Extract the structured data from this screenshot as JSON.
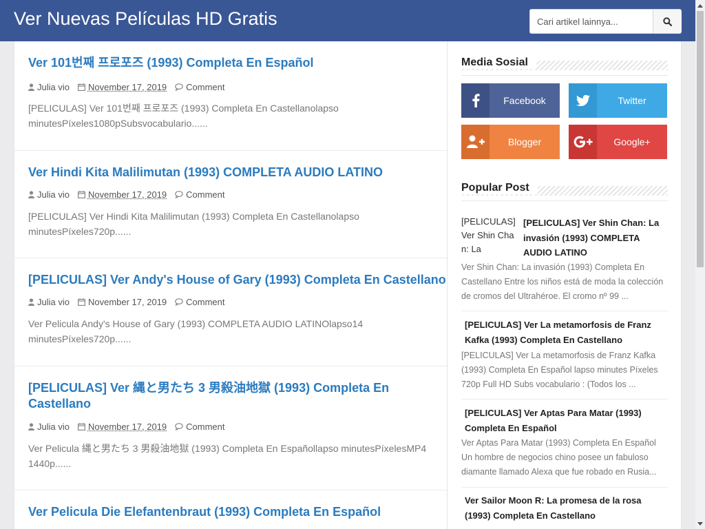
{
  "header": {
    "site_title": "Ver Nuevas Películas HD Gratis",
    "search_placeholder": "Cari artikel lainnya..."
  },
  "posts": [
    {
      "title": "Ver 101번째 프로포즈 (1993) Completa En Español",
      "author": "Julia vio",
      "date": "November 17, 2019",
      "comment_label": "Comment",
      "excerpt": "[PELICULAS] Ver 101번째 프로포즈 (1993) Completa En Castellanolapso minutesPíxeles1080pSubsvocabulario......"
    },
    {
      "title": "Ver Hindi Kita Malilimutan (1993) COMPLETA AUDIO LATINO",
      "author": "Julia vio",
      "date": "November 17, 2019",
      "comment_label": "Comment",
      "excerpt": "[PELICULAS] Ver Hindi Kita Malilimutan (1993) Completa En Castellanolapso minutesPíxeles720p......"
    },
    {
      "title": "[PELICULAS] Ver Andy's House of Gary (1993) Completa En Castellano",
      "author": "Julia vio",
      "date": "November 17, 2019",
      "comment_label": "Comment",
      "excerpt": "Ver Pelicula Andy's House of Gary (1993) COMPLETA AUDIO LATINOlapso14 minutesPíxeles720p......"
    },
    {
      "title": "[PELICULAS] Ver 縄と男たち 3 男殺油地獄 (1993) Completa En Castellano",
      "author": "Julia vio",
      "date": "November 17, 2019",
      "comment_label": "Comment",
      "excerpt": "Ver Pelicula 縄と男たち 3 男殺油地獄 (1993) Completa En Españollapso minutesPíxelesMP4 1440p......"
    },
    {
      "title": "Ver Pelicula Die Elefantenbraut (1993) Completa En Español"
    }
  ],
  "sidebar": {
    "social_title": "Media Sosial",
    "social": [
      {
        "label": "Facebook",
        "icon": "facebook-icon",
        "color": "#4e6397"
      },
      {
        "label": "Twitter",
        "icon": "twitter-icon",
        "color": "#3ea9e5"
      },
      {
        "label": "Blogger",
        "icon": "blogger-icon",
        "color": "#f08342"
      },
      {
        "label": "Google+",
        "icon": "google-plus-icon",
        "color": "#e04744"
      }
    ],
    "popular_title": "Popular Post",
    "popular": [
      {
        "thumb_alt": "[PELICULAS] Ver Shin Chan: La",
        "title": "[PELICULAS] Ver Shin Chan: La invasión (1993) COMPLETA AUDIO LATINO",
        "excerpt": "Ver Shin Chan: La invasión (1993) Completa En Castellano Entre los niños está de moda la colección de cromos del Ultrahéroe. El cromo nº 99 ..."
      },
      {
        "title": "[PELICULAS] Ver La metamorfosis de Franz Kafka (1993) Completa En Castellano",
        "excerpt": "[PELICULAS] Ver La metamorfosis de Franz Kafka (1993) Completa En Español lapso minutes Píxeles 720p Full HD Subs vocabulario : (Todos los ..."
      },
      {
        "title": "[PELICULAS] Ver Aptas Para Matar (1993) Completa En Español",
        "excerpt": "Ver Aptas Para Matar (1993) Completa En Español Un hombre de negocios chino posee un fabuloso diamante llamado Alexa que fue robado en Rusia..."
      },
      {
        "title": "Ver Sailor Moon R: La promesa de la rosa (1993) Completa En Castellano"
      }
    ]
  },
  "colors": {
    "header_bg": "#3a5795",
    "link": "#2b7bbf",
    "page_bg": "#ebebee"
  }
}
